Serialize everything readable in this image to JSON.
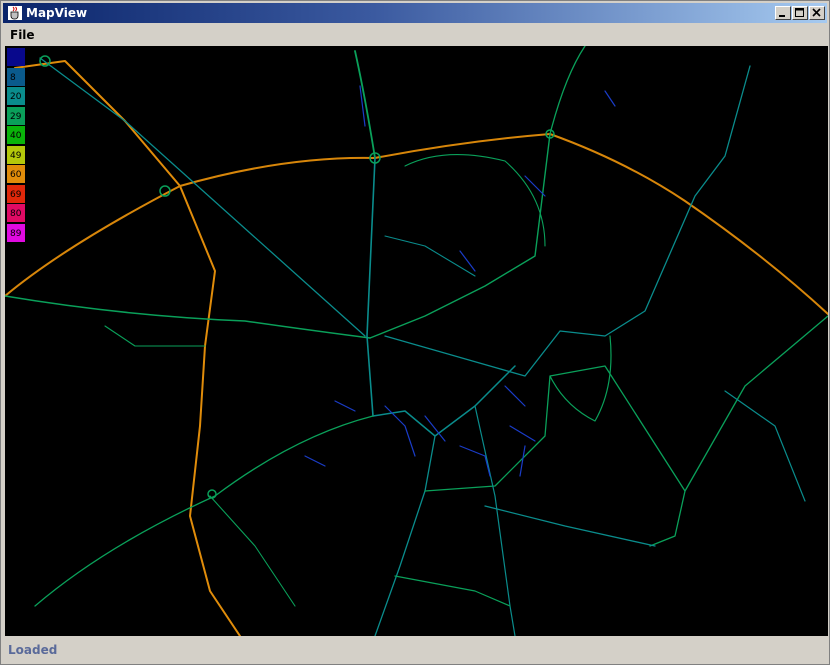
{
  "window": {
    "title": "MapView"
  },
  "menu": {
    "file": "File"
  },
  "legend": {
    "items": [
      {
        "label": "",
        "color": "#08088c"
      },
      {
        "label": "8",
        "color": "#0a5a8c"
      },
      {
        "label": "20",
        "color": "#0a8c8c"
      },
      {
        "label": "29",
        "color": "#0aa05a"
      },
      {
        "label": "40",
        "color": "#0ab40a"
      },
      {
        "label": "49",
        "color": "#b4c80a"
      },
      {
        "label": "60",
        "color": "#e08c0a"
      },
      {
        "label": "69",
        "color": "#e0280a"
      },
      {
        "label": "80",
        "color": "#e00a64"
      },
      {
        "label": "89",
        "color": "#e00ae0"
      }
    ]
  },
  "status": {
    "text": "Loaded"
  },
  "icons": {
    "app": "java-cup-icon",
    "minimize": "minimize-icon",
    "maximize": "maximize-icon",
    "close": "close-icon"
  }
}
